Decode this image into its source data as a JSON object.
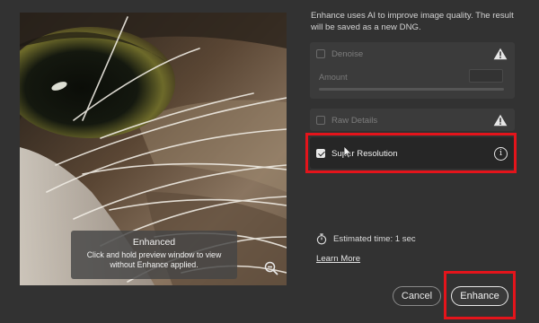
{
  "description": "Enhance uses AI to improve image quality. The result will be saved as a new DNG.",
  "preview": {
    "overlay_title": "Enhanced",
    "overlay_message": "Click and hold preview window to view without Enhance applied.",
    "zoom_icon": "zoom-out-icon"
  },
  "options": {
    "denoise": {
      "label": "Denoise",
      "checked": false,
      "enabled": false,
      "status_icon": "warning-icon"
    },
    "amount": {
      "label": "Amount",
      "value": ""
    },
    "raw_details": {
      "label": "Raw Details",
      "checked": false,
      "enabled": false,
      "status_icon": "warning-icon"
    },
    "super_resolution": {
      "label": "Super Resolution",
      "checked": true,
      "enabled": true,
      "status_icon": "info-icon",
      "info_glyph": "i"
    }
  },
  "estimated_time": "Estimated time: 1 sec",
  "learn_more": "Learn More",
  "buttons": {
    "cancel": "Cancel",
    "enhance": "Enhance"
  },
  "colors": {
    "background": "#323232",
    "highlight": "#e4141b",
    "text": "#d6d6d6",
    "disabled_text": "#7d7d7d"
  }
}
